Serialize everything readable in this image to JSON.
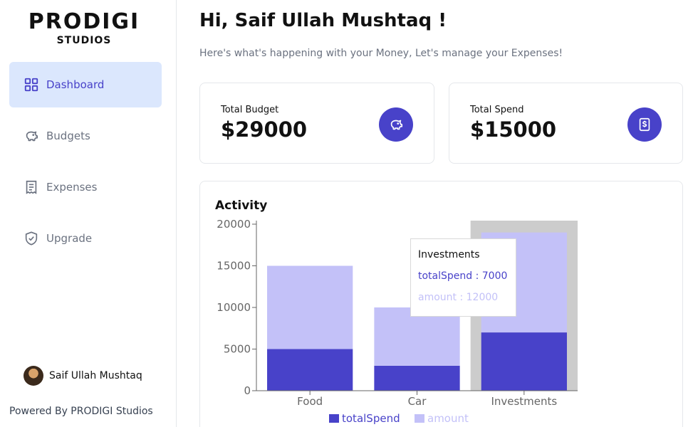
{
  "brand": {
    "name": "PRODIGI",
    "sub": "STUDIOS"
  },
  "sidebar": {
    "items": [
      {
        "label": "Dashboard",
        "icon": "dashboard-grid-icon",
        "active": true
      },
      {
        "label": "Budgets",
        "icon": "piggy-bank-icon",
        "active": false
      },
      {
        "label": "Expenses",
        "icon": "receipt-icon",
        "active": false
      },
      {
        "label": "Upgrade",
        "icon": "shield-check-icon",
        "active": false
      }
    ],
    "user_name": "Saif Ullah Mushtaq",
    "powered_by": "Powered By PRODIGI Studios"
  },
  "header": {
    "greeting": "Hi, Saif Ullah Mushtaq !",
    "subtitle": "Here's what's happening with your Money, Let's manage your Expenses!"
  },
  "stats": [
    {
      "label": "Total Budget",
      "value": "$29000",
      "icon": "piggy-bank-icon"
    },
    {
      "label": "Total Spend",
      "value": "$15000",
      "icon": "receipt-dollar-icon"
    }
  ],
  "activity": {
    "title": "Activity",
    "tooltip": {
      "title": "Investments",
      "line1": "totalSpend : 7000",
      "line2": "amount : 12000"
    }
  },
  "colors": {
    "accent": "#4842c9",
    "accent_light": "#c3c1f8",
    "active_bg": "#dbe7fd",
    "hover_bg": "#cccccc"
  },
  "chart_data": {
    "type": "bar",
    "stacked": true,
    "categories": [
      "Food",
      "Car",
      "Investments"
    ],
    "series": [
      {
        "name": "totalSpend",
        "values": [
          5000,
          3000,
          7000
        ],
        "color": "#4842c9"
      },
      {
        "name": "amount",
        "values": [
          10000,
          7000,
          12000
        ],
        "color": "#c3c1f8"
      }
    ],
    "yticks": [
      "0",
      "5000",
      "10000",
      "15000",
      "20000"
    ],
    "ylim": [
      0,
      20000
    ],
    "legend": "bottom",
    "highlighted_category": "Investments"
  }
}
